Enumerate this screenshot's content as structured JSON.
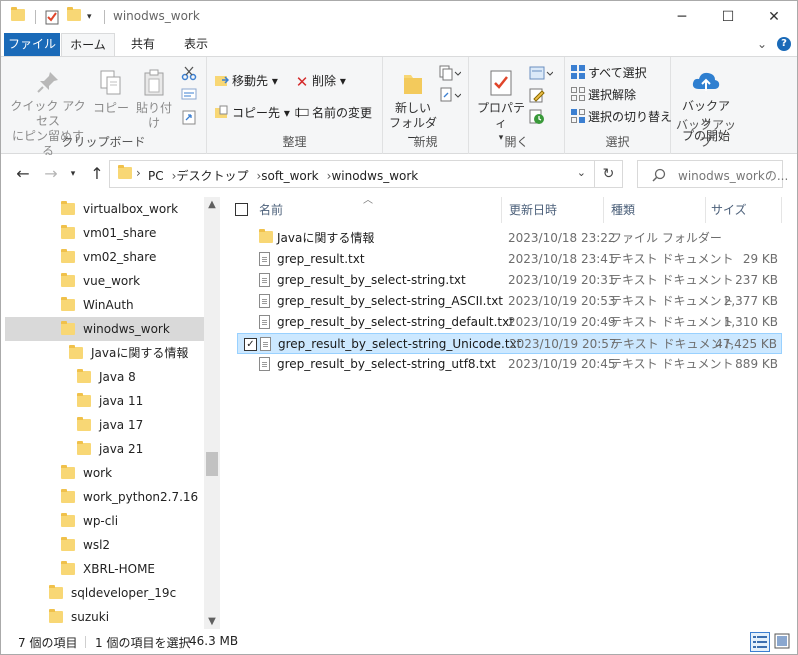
{
  "window": {
    "title": "winodws_work",
    "controls": {
      "minimize": "─",
      "maximize": "☐",
      "close": "✕"
    }
  },
  "ribbon_tabs": {
    "file": "ファイル",
    "home": "ホーム",
    "share": "共有",
    "view": "表示",
    "expand": "⌄",
    "help": "?"
  },
  "ribbon": {
    "clipboard": {
      "label": "クリップボード",
      "pin_line1": "クイック アクセス",
      "pin_line2": "にピン留めする",
      "copy": "コピー",
      "paste": "貼り付け"
    },
    "organize": {
      "label": "整理",
      "move_to": "移動先 ▾",
      "copy_to": "コピー先 ▾",
      "delete": "削除 ▾",
      "rename": "名前の変更"
    },
    "new": {
      "label": "新規",
      "new_folder_line1": "新しい",
      "new_folder_line2": "フォルダー"
    },
    "open": {
      "label": "開く",
      "properties": "プロパティ"
    },
    "select": {
      "label": "選択",
      "select_all": "すべて選択",
      "select_none": "選択解除",
      "invert": "選択の切り替え"
    },
    "backup": {
      "label": "バックアップ",
      "start_line1": "バックアッ",
      "start_line2": "プの開始"
    }
  },
  "address": {
    "crumbs": [
      "PC",
      "デスクトップ",
      "soft_work",
      "winodws_work"
    ],
    "search_placeholder": "winodws_workの..."
  },
  "nav_pane": {
    "items": [
      {
        "label": "virtualbox_work",
        "level": 1
      },
      {
        "label": "vm01_share",
        "level": 1
      },
      {
        "label": "vm02_share",
        "level": 1
      },
      {
        "label": "vue_work",
        "level": 1
      },
      {
        "label": "WinAuth",
        "level": 1
      },
      {
        "label": "winodws_work",
        "level": 1,
        "selected": true
      },
      {
        "label": "Javaに関する情報",
        "level": 2
      },
      {
        "label": "Java 8",
        "level": 3
      },
      {
        "label": "java 11",
        "level": 3
      },
      {
        "label": "java 17",
        "level": 3
      },
      {
        "label": "java 21",
        "level": 3
      },
      {
        "label": "work",
        "level": 1
      },
      {
        "label": "work_python2.7.16",
        "level": 1
      },
      {
        "label": "wp-cli",
        "level": 1
      },
      {
        "label": "wsl2",
        "level": 1
      },
      {
        "label": "XBRL-HOME",
        "level": 1
      },
      {
        "label": "sqldeveloper_19c",
        "level": 0
      },
      {
        "label": "suzuki",
        "level": 0
      }
    ]
  },
  "columns": {
    "name": "名前",
    "date": "更新日時",
    "type": "種類",
    "size": "サイズ"
  },
  "files": [
    {
      "name": "Javaに関する情報",
      "date": "2023/10/18 23:22",
      "type": "ファイル フォルダー",
      "size": "",
      "kind": "folder"
    },
    {
      "name": "grep_result.txt",
      "date": "2023/10/18 23:41",
      "type": "テキスト ドキュメント",
      "size": "29 KB",
      "kind": "text"
    },
    {
      "name": "grep_result_by_select-string.txt",
      "date": "2023/10/19 20:31",
      "type": "テキスト ドキュメント",
      "size": "237 KB",
      "kind": "text"
    },
    {
      "name": "grep_result_by_select-string_ASCII.txt",
      "date": "2023/10/19 20:53",
      "type": "テキスト ドキュメント",
      "size": "2,377 KB",
      "kind": "text"
    },
    {
      "name": "grep_result_by_select-string_default.txt",
      "date": "2023/10/19 20:49",
      "type": "テキスト ドキュメント",
      "size": "1,310 KB",
      "kind": "text"
    },
    {
      "name": "grep_result_by_select-string_Unicode.txt",
      "date": "2023/10/19 20:57",
      "type": "テキスト ドキュメント",
      "size": "47,425 KB",
      "kind": "text",
      "selected": true
    },
    {
      "name": "grep_result_by_select-string_utf8.txt",
      "date": "2023/10/19 20:45",
      "type": "テキスト ドキュメント",
      "size": "889 KB",
      "kind": "text"
    }
  ],
  "status": {
    "item_count": "7 個の項目",
    "selection": "1 個の項目を選択",
    "selection_size": "46.3 MB"
  },
  "colors": {
    "file_tab": "#1a6ab8",
    "selection_bg": "#cce8ff",
    "folder": "#f8d775"
  }
}
